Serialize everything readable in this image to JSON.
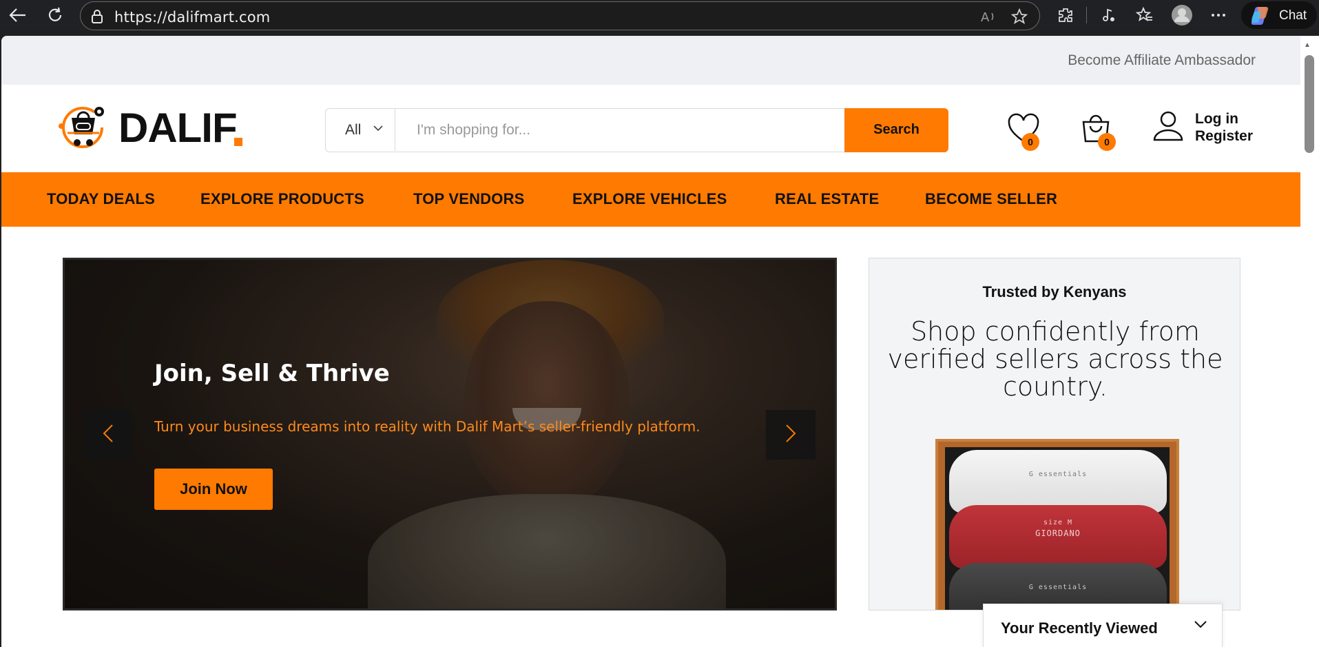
{
  "browser": {
    "url": "https://dalifmart.com",
    "chat_label": "Chat"
  },
  "topbar": {
    "affiliate_link": "Become Affiliate Ambassador"
  },
  "header": {
    "logo_text": "DALIF",
    "search": {
      "category": "All",
      "placeholder": "I'm shopping for...",
      "button": "Search"
    },
    "wishlist_count": "0",
    "cart_count": "0",
    "login": "Log in",
    "register": "Register"
  },
  "nav": {
    "items": [
      "TODAY DEALS",
      "EXPLORE PRODUCTS",
      "TOP VENDORS",
      "EXPLORE VEHICLES",
      "REAL ESTATE",
      "BECOME SELLER"
    ]
  },
  "hero": {
    "title": "Join, Sell & Thrive",
    "subtitle": "Turn your business dreams into reality with Dalif Mart’s seller-friendly platform.",
    "button": "Join Now",
    "slides": 2
  },
  "side_card": {
    "heading": "Trusted by Kenyans",
    "body": "Shop confidently from verified sellers across the country.",
    "shirt_labels": [
      "G essentials",
      "GIORDANO",
      "G essentials"
    ],
    "shirt_size": "size M"
  },
  "recently_viewed": {
    "label": "Your Recently Viewed"
  },
  "colors": {
    "accent": "#ff7a00",
    "topstrip": "#eff0f3"
  }
}
